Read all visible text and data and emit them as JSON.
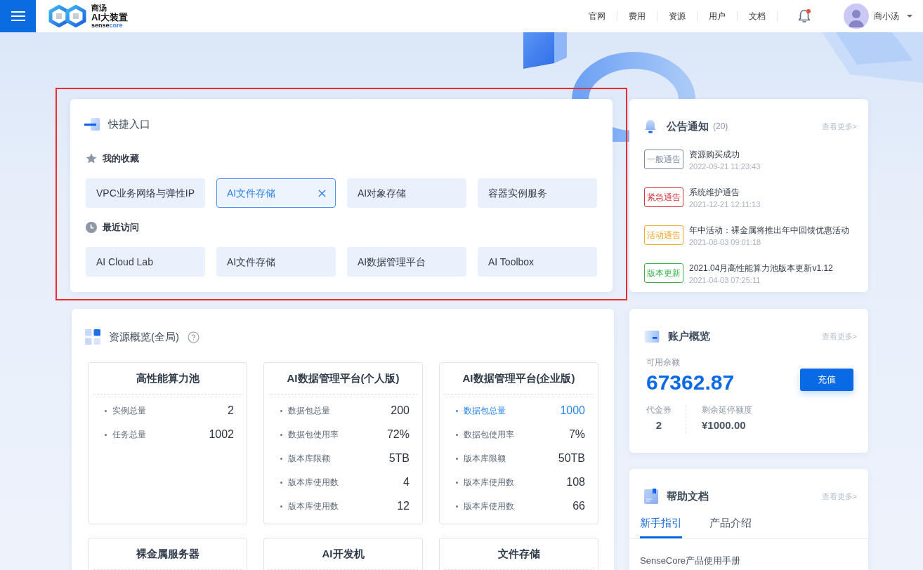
{
  "header": {
    "logo": {
      "line_1": "商汤",
      "line_2": "AI大装置",
      "wordmark": [
        "sense",
        "core"
      ]
    },
    "nav": [
      "官网",
      "费用",
      "资源",
      "用户",
      "文档"
    ],
    "notifications": {
      "unread": true
    },
    "user": {
      "name": "商小汤"
    }
  },
  "quick_entry": {
    "highlighted": true,
    "title": "快捷入口",
    "sections": [
      {
        "kind": "favorites",
        "title": "我的收藏",
        "items": [
          {
            "label": "VPC业务网络与弹性IP",
            "selected": false
          },
          {
            "label": "AI文件存储",
            "selected": true
          },
          {
            "label": "AI对象存储",
            "selected": false
          },
          {
            "label": "容器实例服务",
            "selected": false
          }
        ]
      },
      {
        "kind": "recent",
        "title": "最近访问",
        "items": [
          {
            "label": "AI Cloud Lab",
            "selected": false
          },
          {
            "label": "AI文件存储",
            "selected": false
          },
          {
            "label": "AI数据管理平台",
            "selected": false
          },
          {
            "label": "AI Toolbox",
            "selected": false
          }
        ]
      }
    ]
  },
  "resources": {
    "title": "资源概览(全局)",
    "cards": [
      {
        "title": "高性能算力池",
        "rows": [
          {
            "label": "实例总量",
            "value": "2",
            "highlighted": false
          },
          {
            "label": "任务总量",
            "value": "1002",
            "highlighted": false
          }
        ]
      },
      {
        "title": "AI数据管理平台(个人版)",
        "rows": [
          {
            "label": "数据包总量",
            "value": "200",
            "highlighted": false
          },
          {
            "label": "数据包使用率",
            "value": "72%",
            "highlighted": false
          },
          {
            "label": "版本库限额",
            "value": "5TB",
            "highlighted": false
          },
          {
            "label": "版本库使用数",
            "value": "4",
            "highlighted": false
          },
          {
            "label": "版本库使用数",
            "value": "12",
            "highlighted": false
          }
        ]
      },
      {
        "title": "AI数据管理平台(企业版)",
        "rows": [
          {
            "label": "数据包总量",
            "value": "1000",
            "highlighted": true
          },
          {
            "label": "数据包使用率",
            "value": "7%",
            "highlighted": false
          },
          {
            "label": "版本库限额",
            "value": "50TB",
            "highlighted": false
          },
          {
            "label": "版本库使用数",
            "value": "108",
            "highlighted": false
          },
          {
            "label": "版本库使用数",
            "value": "66",
            "highlighted": false
          }
        ]
      },
      {
        "title": "裸金属服务器"
      },
      {
        "title": "AI开发机"
      },
      {
        "title": "文件存储"
      }
    ]
  },
  "announcements": {
    "title": "公告通知",
    "count": "(20)",
    "more": "查看更多>",
    "items": [
      {
        "tag": "一般通告",
        "color": "#7d8ca2",
        "title": "资源购买成功",
        "time": "2022-09-21 11:23:43"
      },
      {
        "tag": "紧急通告",
        "color": "#d9363e",
        "title": "系统维护通告",
        "time": "2021-12-21 12:11:13"
      },
      {
        "tag": "活动通告",
        "color": "#f5a623",
        "title": "年中活动：裸金属将推出年中回馈优惠活动",
        "time": "2021-08-03 09:01:18"
      },
      {
        "tag": "版本更新",
        "color": "#36b34a",
        "title": "2021.04月高性能算力池版本更新v1.12",
        "time": "2021-04-03 07:25:11"
      }
    ]
  },
  "account": {
    "title": "账户概览",
    "more": "查看更多>",
    "balance_label": "可用余额",
    "balance": "67362.87",
    "recharge": "充值",
    "voucher_label": "代金券",
    "voucher": "2",
    "credit_label": "剩余延停额度",
    "credit": "¥1000.00"
  },
  "help": {
    "title": "帮助文档",
    "more": "查看更多>",
    "tabs": [
      {
        "label": "新手指引",
        "selected": true
      },
      {
        "label": "产品介绍",
        "selected": false
      }
    ],
    "items": [
      "SenseCore产品使用手册"
    ]
  }
}
